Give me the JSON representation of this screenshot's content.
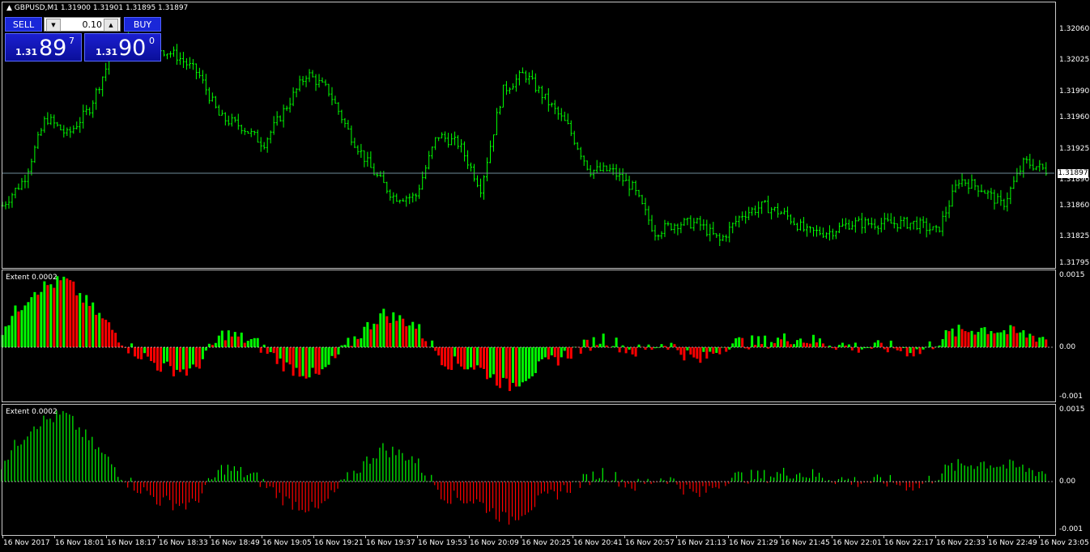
{
  "main": {
    "title": "GBPUSD,M1  1.31900 1.31901 1.31895 1.31897",
    "current_price": "1.31897",
    "price_levels": [
      "1.32060",
      "1.32025",
      "1.31990",
      "1.31960",
      "1.31925",
      "1.31890",
      "1.31860",
      "1.31825",
      "1.31795"
    ],
    "price_range": [
      1.31795,
      1.3206
    ],
    "line_color": "#00ff00",
    "price_line_color": "#6e8b9a"
  },
  "trade_panel": {
    "sell_label": "SELL",
    "buy_label": "BUY",
    "lot": "0.10",
    "sell_small": "1.31",
    "sell_big": "89",
    "sell_sup": "7",
    "buy_small": "1.31",
    "buy_big": "90",
    "buy_sup": "0"
  },
  "indicator1": {
    "label": "Extent 0.0002",
    "levels": [
      "0.0015",
      "0.00",
      "-0.001"
    ],
    "up_color": "#00ff00",
    "down_color": "#ff0000"
  },
  "indicator2": {
    "label": "Extent 0.0002",
    "levels": [
      "0.0015",
      "0.00",
      "-0.001"
    ],
    "up_color": "#00ff00",
    "down_color": "#ff0000"
  },
  "time_axis": [
    "16 Nov 2017",
    "16 Nov 18:01",
    "16 Nov 18:17",
    "16 Nov 18:33",
    "16 Nov 18:49",
    "16 Nov 19:05",
    "16 Nov 19:21",
    "16 Nov 19:37",
    "16 Nov 19:53",
    "16 Nov 20:09",
    "16 Nov 20:25",
    "16 Nov 20:41",
    "16 Nov 20:57",
    "16 Nov 21:13",
    "16 Nov 21:29",
    "16 Nov 21:45",
    "16 Nov 22:01",
    "16 Nov 22:17",
    "16 Nov 22:33",
    "16 Nov 22:49",
    "16 Nov 23:05"
  ],
  "chart_data": {
    "type": "bar",
    "series_name": "GBPUSD,M1",
    "close_profile": [
      1.3186,
      1.3189,
      1.3196,
      1.3194,
      1.3197,
      1.3203,
      1.3205,
      1.3204,
      1.3203,
      1.3201,
      1.3196,
      1.3195,
      1.3193,
      1.3197,
      1.3201,
      1.3199,
      1.3194,
      1.319,
      1.3187,
      1.3187,
      1.3194,
      1.3193,
      1.3188,
      1.3199,
      1.3201,
      1.3198,
      1.3195,
      1.319,
      1.319,
      1.3188,
      1.3183,
      1.3184,
      1.3184,
      1.3182,
      1.3185,
      1.3186,
      1.3185,
      1.3183,
      1.3183,
      1.3184,
      1.3184,
      1.3184,
      1.3184,
      1.3183,
      1.3189,
      1.3188,
      1.3186,
      1.3191,
      1.319
    ],
    "osc_profile": [
      0.0004,
      0.0012,
      0.0014,
      0.0007,
      0.0,
      -0.0004,
      -0.0005,
      0.0003,
      0.0001,
      -0.0004,
      -0.0006,
      0.0001,
      0.0007,
      0.0005,
      -0.0003,
      -0.0004,
      -0.0008,
      -0.0004,
      -0.0001,
      0.0002,
      -0.0001,
      0.0001,
      -0.0003,
      0.0001,
      0.0001,
      0.0002,
      0.0001,
      0.0,
      0.0,
      -0.0001,
      0.0003,
      0.0004,
      0.0003,
      0.0002
    ]
  }
}
